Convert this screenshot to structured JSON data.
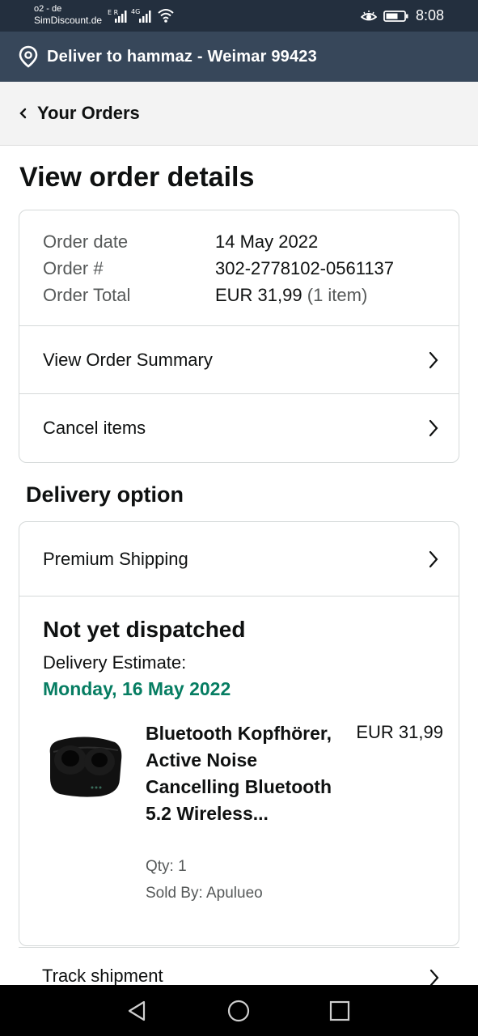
{
  "status_bar": {
    "carrier_line1": "o2 - de",
    "carrier_line2": "SimDiscount.de",
    "network_1": "E",
    "network_2": "4G",
    "time": "8:08"
  },
  "delivery_bar": {
    "text": "Deliver to hammaz - Weimar 99423",
    "icon": "location-pin-icon"
  },
  "nav": {
    "back_label": "Your Orders",
    "icon": "chevron-left-icon"
  },
  "page_title": "View order details",
  "order_info": {
    "date_label": "Order date",
    "date_value": "14 May 2022",
    "number_label": "Order #",
    "number_value": "302-2778102-0561137",
    "total_label": "Order Total",
    "total_value": "EUR 31,99",
    "total_items": "(1 item)"
  },
  "order_actions": {
    "summary_label": "View Order Summary",
    "cancel_label": "Cancel items"
  },
  "delivery_section_title": "Delivery option",
  "shipment": {
    "shipping_method": "Premium Shipping",
    "status": "Not yet dispatched",
    "estimate_label": "Delivery Estimate:",
    "estimate_date": "Monday, 16 May 2022",
    "product": {
      "title": "Bluetooth Kopfhörer, Active Noise Cancelling Bluetooth 5.2 Wireless...",
      "price": "EUR 31,99",
      "qty": "Qty: 1",
      "seller": "Sold By: Apulueo"
    },
    "track_label": "Track shipment"
  },
  "colors": {
    "status_bar": "#232f3e",
    "delivery_bar": "#37475a",
    "nav_bg": "#f3f3f3",
    "delivery_date": "#067d62"
  }
}
